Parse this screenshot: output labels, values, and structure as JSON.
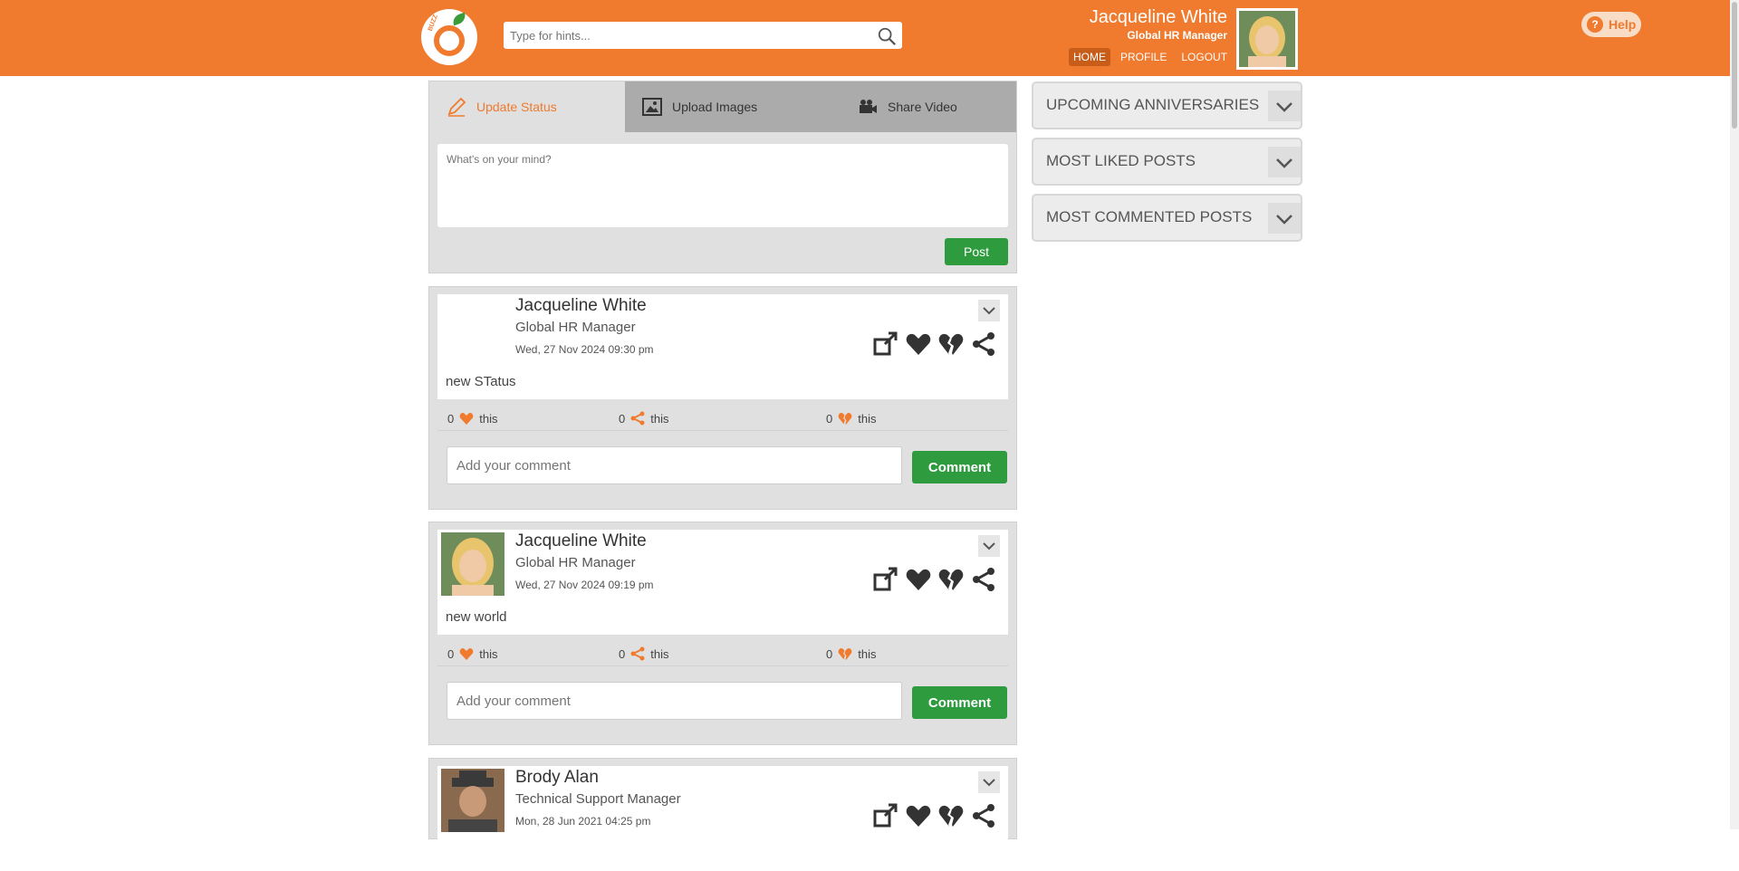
{
  "header": {
    "logo_text": "BUZZ",
    "search_placeholder": "Type for hints...",
    "user_name": "Jacqueline White",
    "user_title": "Global HR Manager",
    "nav": [
      "HOME",
      "PROFILE",
      "LOGOUT"
    ],
    "help_label": "Help"
  },
  "composer": {
    "tabs": [
      "Update Status",
      "Upload Images",
      "Share Video"
    ],
    "status_placeholder": "What's on your mind?",
    "post_label": "Post"
  },
  "posts": [
    {
      "author": "Jacqueline White",
      "title": "Global HR Manager",
      "date": "Wed, 27 Nov 2024  09:30 pm",
      "content": "new STatus",
      "likes": "0",
      "shares": "0",
      "dislikes": "0",
      "this_label": "this",
      "comment_placeholder": "Add your comment",
      "comment_label": "Comment"
    },
    {
      "author": "Jacqueline White",
      "title": "Global HR Manager",
      "date": "Wed, 27 Nov 2024  09:19 pm",
      "content": "new world",
      "likes": "0",
      "shares": "0",
      "dislikes": "0",
      "this_label": "this",
      "comment_placeholder": "Add your comment",
      "comment_label": "Comment"
    },
    {
      "author": "Brody Alan",
      "title": "Technical Support Manager",
      "date": "Mon, 28 Jun 2021  04:25 pm"
    }
  ],
  "widgets": [
    "UPCOMING ANNIVERSARIES",
    "MOST LIKED POSTS",
    "MOST COMMENTED POSTS"
  ],
  "colors": {
    "brand": "#f07a2e",
    "button_green": "#2e9b3f"
  }
}
